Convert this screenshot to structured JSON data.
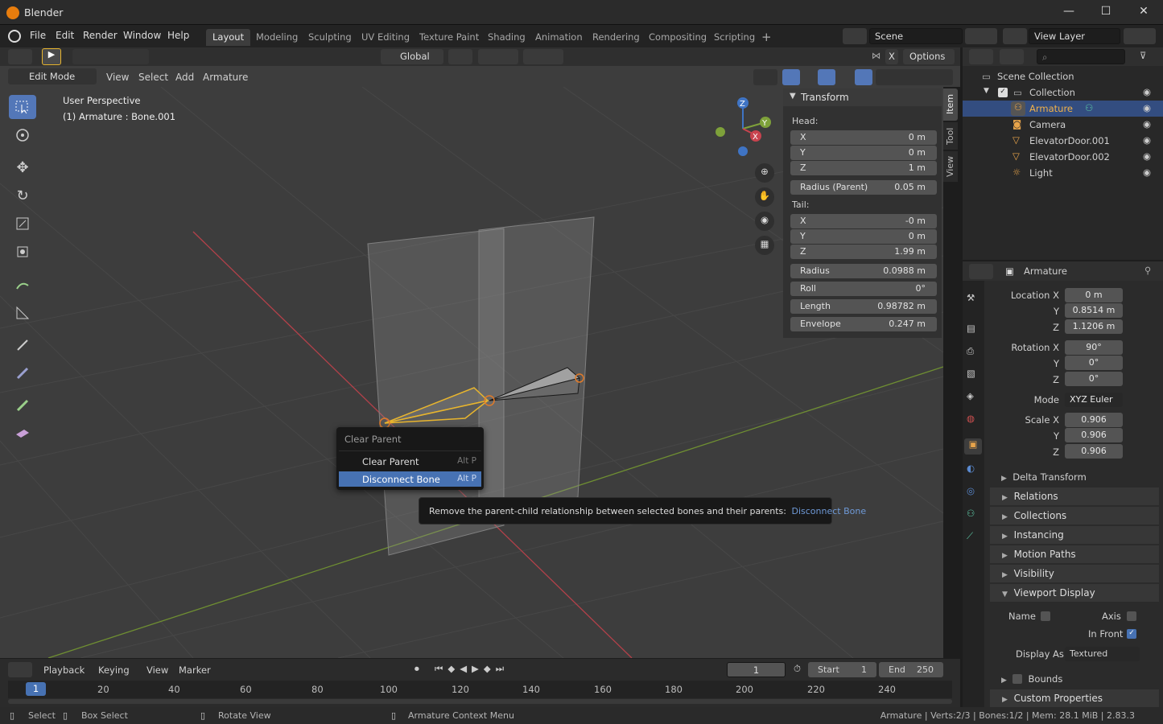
{
  "window": {
    "title": "Blender",
    "minimize": "—",
    "maximize": "☐",
    "close": "✕"
  },
  "menu": {
    "items": [
      "File",
      "Edit",
      "Render",
      "Window",
      "Help"
    ]
  },
  "workspaces": {
    "tabs": [
      "Layout",
      "Modeling",
      "Sculpting",
      "UV Editing",
      "Texture Paint",
      "Shading",
      "Animation",
      "Rendering",
      "Compositing",
      "Scripting"
    ],
    "active": "Layout",
    "add": "+"
  },
  "scene": {
    "name": "Scene",
    "view_layer": "View Layer"
  },
  "tool_header": {
    "orientation": "Global",
    "options": "Options",
    "x_axis": "X"
  },
  "viewport_header": {
    "mode": "Edit Mode",
    "menus": [
      "View",
      "Select",
      "Add",
      "Armature"
    ]
  },
  "viewport": {
    "perspective": "User Perspective",
    "active": "(1) Armature : Bone.001"
  },
  "gizmo": {
    "x": "X",
    "y": "Y",
    "z": "Z"
  },
  "npanel": {
    "title": "Transform",
    "tabs": [
      "Item",
      "Tool",
      "View"
    ],
    "head_label": "Head:",
    "head": [
      {
        "l": "X",
        "v": "0 m"
      },
      {
        "l": "Y",
        "v": "0 m"
      },
      {
        "l": "Z",
        "v": "1 m"
      }
    ],
    "radius_parent": {
      "l": "Radius (Parent)",
      "v": "0.05 m"
    },
    "tail_label": "Tail:",
    "tail": [
      {
        "l": "X",
        "v": "-0 m"
      },
      {
        "l": "Y",
        "v": "0 m"
      },
      {
        "l": "Z",
        "v": "1.99 m"
      }
    ],
    "extra": [
      {
        "l": "Radius",
        "v": "0.0988 m"
      },
      {
        "l": "Roll",
        "v": "0°"
      },
      {
        "l": "Length",
        "v": "0.98782 m"
      },
      {
        "l": "Envelope",
        "v": "0.247 m"
      }
    ]
  },
  "context_menu": {
    "title": "Clear Parent",
    "items": [
      {
        "label": "Clear Parent",
        "shortcut": "Alt P"
      },
      {
        "label": "Disconnect Bone",
        "shortcut": "Alt P"
      }
    ]
  },
  "tooltip": {
    "text": "Remove the parent-child relationship between selected bones and their parents:",
    "python": "Disconnect Bone"
  },
  "outliner": {
    "root": "Scene Collection",
    "collection": "Collection",
    "items": [
      "Armature",
      "Camera",
      "ElevatorDoor.001",
      "ElevatorDoor.002",
      "Light"
    ]
  },
  "properties": {
    "object_name": "Armature",
    "location_label": "Location X",
    "location": [
      "0 m",
      "0.8514 m",
      "1.1206 m"
    ],
    "rotation_label": "Rotation X",
    "rotation": [
      "90°",
      "0°",
      "0°"
    ],
    "mode_label": "Mode",
    "mode": "XYZ Euler",
    "scale_label": "Scale X",
    "scale": [
      "0.906",
      "0.906",
      "0.906"
    ],
    "y_label": "Y",
    "z_label": "Z",
    "delta": "Delta Transform",
    "sections": [
      "Relations",
      "Collections",
      "Instancing",
      "Motion Paths",
      "Visibility",
      "Viewport Display"
    ],
    "vd_name": "Name",
    "vd_axis": "Axis",
    "vd_infront": "In Front",
    "vd_display_as_label": "Display As",
    "vd_display_as": "Textured",
    "vd_bounds": "Bounds",
    "custom": "Custom Properties"
  },
  "timeline": {
    "menus": [
      "Playback",
      "Keying",
      "View",
      "Marker"
    ],
    "current_frame": "1",
    "start_label": "Start",
    "start": "1",
    "end_label": "End",
    "end": "250",
    "marks": [
      "1",
      "20",
      "40",
      "60",
      "80",
      "100",
      "120",
      "140",
      "160",
      "180",
      "200",
      "220",
      "240"
    ]
  },
  "statusbar": {
    "select": "Select",
    "box_select": "Box Select",
    "rotate": "Rotate View",
    "context": "Armature Context Menu",
    "info": "Armature | Verts:2/3 | Bones:1/2 | Mem: 28.1 MiB | 2.83.3"
  },
  "colors": {
    "accent": "#5377b8",
    "selected_bone": "#e8b52e",
    "axis_x": "#c8434e",
    "axis_y": "#7ea13a"
  }
}
